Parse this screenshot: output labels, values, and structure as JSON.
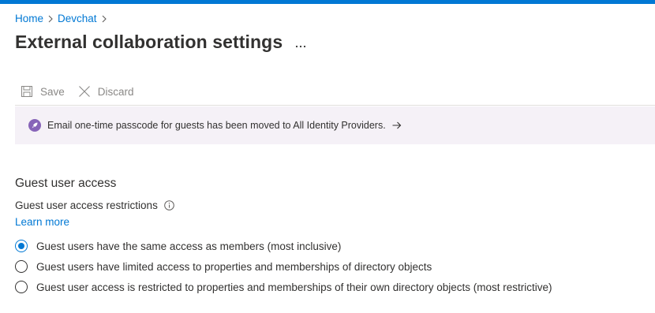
{
  "breadcrumb": {
    "items": [
      "Home",
      "Devchat"
    ]
  },
  "page": {
    "title": "External collaboration settings",
    "more_label": "···"
  },
  "toolbar": {
    "save_label": "Save",
    "discard_label": "Discard",
    "save_icon": "save-icon",
    "discard_icon": "close-icon"
  },
  "banner": {
    "icon": "rocket-icon",
    "text": "Email one-time passcode for guests has been moved to All Identity Providers.",
    "arrow_icon": "arrow-right-icon"
  },
  "guest_access": {
    "section_title": "Guest user access",
    "field_label": "Guest user access restrictions",
    "learn_more": "Learn more",
    "options": [
      {
        "label": "Guest users have the same access as members (most inclusive)",
        "selected": true
      },
      {
        "label": "Guest users have limited access to properties and memberships of directory objects",
        "selected": false
      },
      {
        "label": "Guest user access is restricted to properties and memberships of their own directory objects (most restrictive)",
        "selected": false
      }
    ]
  },
  "colors": {
    "accent": "#0078d4",
    "banner_bg": "#f5f1f7",
    "banner_icon": "#8764b8",
    "disabled_text": "#8a8886"
  }
}
